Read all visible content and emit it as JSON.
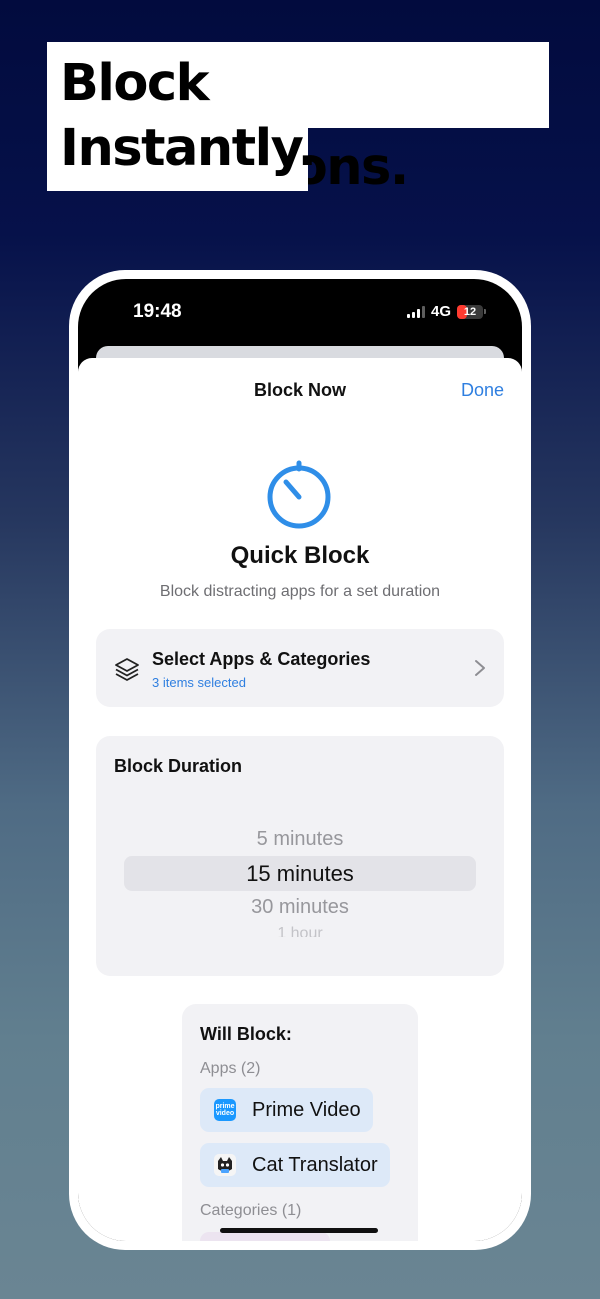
{
  "headline": {
    "line1": "Block Distractions.",
    "line2": "Instantly."
  },
  "status_bar": {
    "time": "19:48",
    "network": "4G",
    "battery": "12"
  },
  "sheet": {
    "title": "Block Now",
    "done_label": "Done"
  },
  "hero": {
    "icon": "timer-icon",
    "title": "Quick Block",
    "subtitle": "Block distracting apps for a set duration"
  },
  "select_apps": {
    "icon": "layers-icon",
    "title": "Select Apps & Categories",
    "subtitle": "3 items selected"
  },
  "duration": {
    "title": "Block Duration",
    "options": [
      "5 minutes",
      "15 minutes",
      "30 minutes",
      "1 hour"
    ],
    "selected": "15 minutes"
  },
  "will_block": {
    "title": "Will Block:",
    "apps_label": "Apps (2)",
    "apps": [
      {
        "name": "Prime Video",
        "icon": "prime-video-icon",
        "icon_text": "prime video"
      },
      {
        "name": "Cat Translator",
        "icon": "cat-translator-icon"
      }
    ],
    "categories_label": "Categories (1)"
  },
  "colors": {
    "accent": "#2f7fe0",
    "background_top": "#020b3e",
    "background_bottom": "#6a8593",
    "battery_low": "#ff3b30"
  }
}
